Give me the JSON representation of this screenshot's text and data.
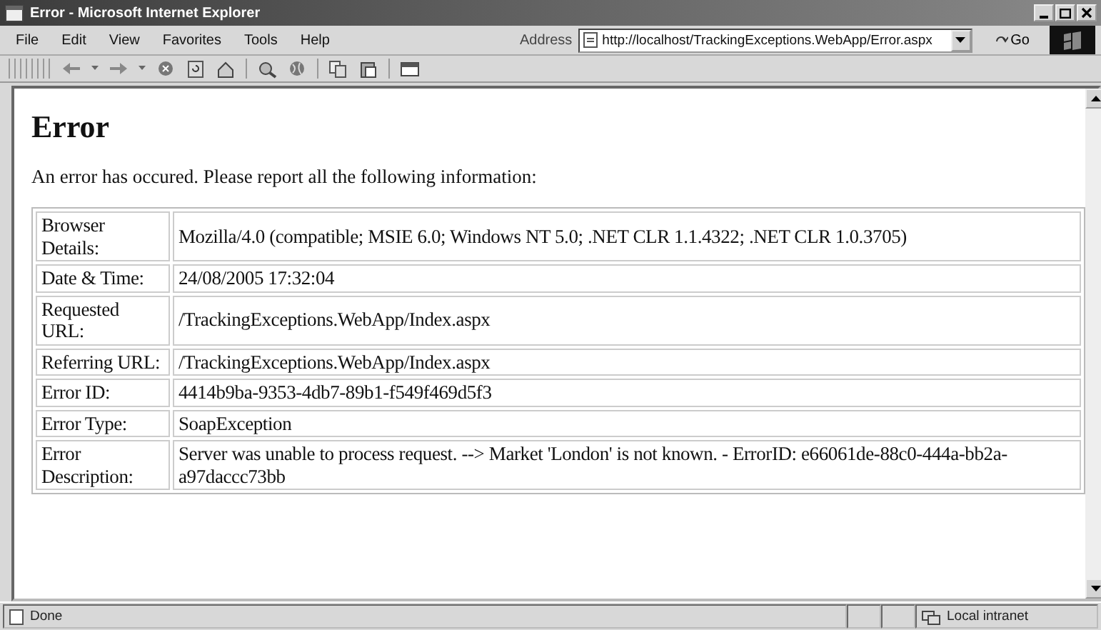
{
  "window": {
    "title": "Error - Microsoft Internet Explorer"
  },
  "menu": [
    "File",
    "Edit",
    "View",
    "Favorites",
    "Tools",
    "Help"
  ],
  "address": {
    "label": "Address",
    "value": "http://localhost/TrackingExceptions.WebApp/Error.aspx",
    "go": "Go"
  },
  "page": {
    "heading": "Error",
    "intro": "An error has occured. Please report all the following information:",
    "rows": [
      {
        "label": "Browser Details:",
        "value": "Mozilla/4.0 (compatible; MSIE 6.0; Windows NT 5.0; .NET CLR 1.1.4322; .NET CLR 1.0.3705)"
      },
      {
        "label": "Date & Time:",
        "value": "24/08/2005 17:32:04"
      },
      {
        "label": "Requested URL:",
        "value": "/TrackingExceptions.WebApp/Index.aspx"
      },
      {
        "label": "Referring URL:",
        "value": "/TrackingExceptions.WebApp/Index.aspx"
      },
      {
        "label": "Error ID:",
        "value": "4414b9ba-9353-4db7-89b1-f549f469d5f3"
      },
      {
        "label": "Error Type:",
        "value": "SoapException"
      },
      {
        "label": "Error Description:",
        "value": "Server was unable to process request. --> Market 'London' is not known. - ErrorID: e66061de-88c0-444a-bb2a-a97daccc73bb"
      }
    ]
  },
  "status_bar": {
    "text": "Done",
    "zone": "Local intranet"
  }
}
